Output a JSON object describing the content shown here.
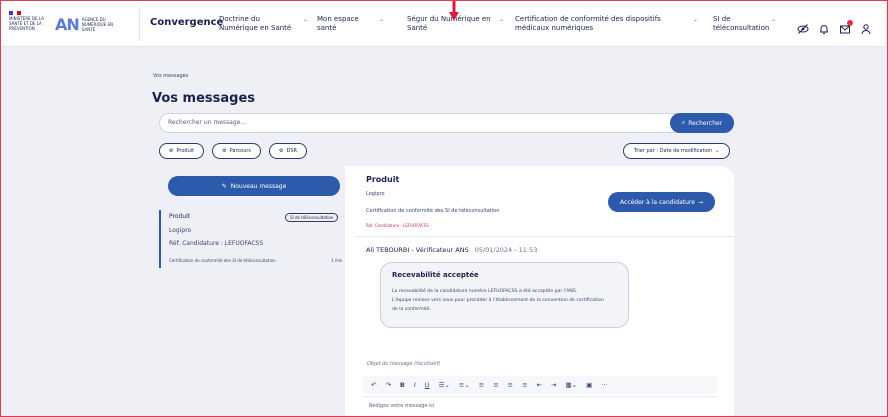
{
  "header": {
    "gov_logo_text": "MINISTÈRE DE LA SANTÉ ET DE LA PRÉVENTION",
    "agency_logo_mark": "AN",
    "agency_logo_text": "AGENCE DU NUMÉRIQUE EN SANTÉ",
    "brand": "Convergence",
    "nav": [
      {
        "label": "Doctrine du Numérique en Santé"
      },
      {
        "label": "Mon espace santé"
      },
      {
        "label": "Ségur du Numérique en Santé"
      },
      {
        "label": "Certification de conformité des dispositifs médicaux numériques"
      },
      {
        "label": "SI de téléconsultation"
      }
    ]
  },
  "breadcrumb": "Vos messages",
  "page_title": "Vos messages",
  "search": {
    "placeholder": "Rechercher un message...",
    "button_label": "Rechercher"
  },
  "filters": [
    {
      "label": "Produit"
    },
    {
      "label": "Parcours"
    },
    {
      "label": "DSR"
    }
  ],
  "sort": {
    "label": "Trier par : Date de modification"
  },
  "sidebar": {
    "new_message_label": "Nouveau message",
    "messages": [
      {
        "product": "Produit",
        "badge": "SI de téléconsultation",
        "name": "Logipro",
        "reference": "Réf. Candidature : LEFUOFACSS",
        "summary": "Certification de conformité des SI de téléconsultation",
        "time": "1 min"
      }
    ]
  },
  "detail": {
    "title": "Produit",
    "product_name": "Logipro",
    "certification": "Certification de conformité des SI de téléconsultation",
    "reference": "Réf. Candidature : LEFUOFACSS",
    "action_label": "Accéder à la candidature",
    "author": "Ali TEBOURBI - Vérificateur ANS",
    "date": "05/01/2024 - 11:53",
    "card": {
      "title": "Recevabilité acceptée",
      "body_line1": "La recevabilité de la candidature numéro LEFUOFACSS a été acceptée par l'ANS.",
      "body_line2": "L'équipe reviens vers vous pour procéder à l'établissement de la convention de certification",
      "body_line3": "de la conformité."
    },
    "editor": {
      "subject_placeholder": "Objet du message (facultatif)",
      "body_placeholder": "Redigez votre message ici"
    }
  },
  "colors": {
    "primary": "#2E5AAC",
    "navy": "#1B2250",
    "alert": "#E0304A",
    "background": "#EEF0F5"
  }
}
